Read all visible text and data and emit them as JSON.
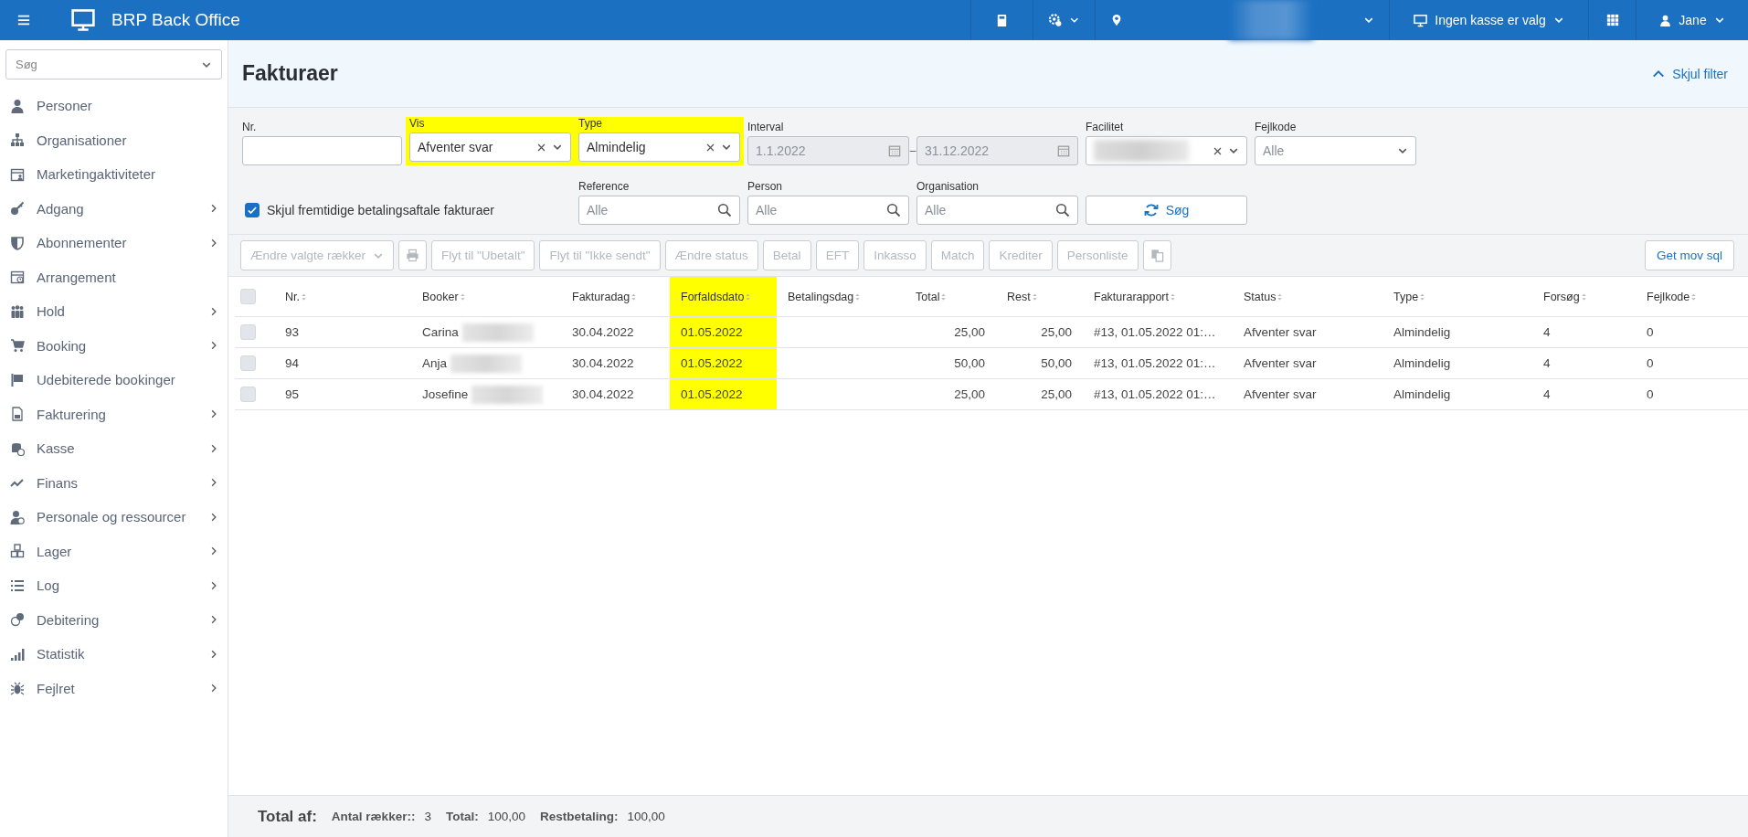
{
  "topbar": {
    "title": "BRP Back Office",
    "items": [
      {
        "kind": "book",
        "dropdown": false
      },
      {
        "kind": "settings",
        "dropdown": true
      },
      {
        "kind": "location",
        "blurred": true,
        "dropdown": true
      },
      {
        "kind": "register",
        "label": "Ingen kasse er valg",
        "dropdown": true
      },
      {
        "kind": "apps",
        "dropdown": false
      },
      {
        "kind": "user",
        "label": "Jane",
        "dropdown": true
      }
    ]
  },
  "sidebar": {
    "search": {
      "placeholder": "Søg"
    },
    "items": [
      {
        "label": "Personer",
        "has_submenu": false
      },
      {
        "label": "Organisationer",
        "has_submenu": false
      },
      {
        "label": "Marketingaktiviteter",
        "has_submenu": false
      },
      {
        "label": "Adgang",
        "has_submenu": true
      },
      {
        "label": "Abonnementer",
        "has_submenu": true
      },
      {
        "label": "Arrangement",
        "has_submenu": false
      },
      {
        "label": "Hold",
        "has_submenu": true
      },
      {
        "label": "Booking",
        "has_submenu": true
      },
      {
        "label": "Udebiterede bookinger",
        "has_submenu": false
      },
      {
        "label": "Fakturering",
        "has_submenu": true
      },
      {
        "label": "Kasse",
        "has_submenu": true
      },
      {
        "label": "Finans",
        "has_submenu": true
      },
      {
        "label": "Personale og ressourcer",
        "has_submenu": true
      },
      {
        "label": "Lager",
        "has_submenu": true
      },
      {
        "label": "Log",
        "has_submenu": true
      },
      {
        "label": "Debitering",
        "has_submenu": true
      },
      {
        "label": "Statistik",
        "has_submenu": true
      },
      {
        "label": "Fejlret",
        "has_submenu": true
      }
    ]
  },
  "page": {
    "title": "Fakturaer",
    "filter_toggle": "Skjul filter"
  },
  "filters": {
    "row1": [
      {
        "kind": "input",
        "label": "Nr.",
        "highlighted": false
      },
      {
        "kind": "select",
        "label": "Vis",
        "value": "Afventer svar",
        "clearable": true,
        "highlighted": true
      },
      {
        "kind": "select",
        "label": "Type",
        "value": "Almindelig",
        "clearable": true,
        "highlighted": true
      },
      {
        "kind": "range",
        "label": "Interval",
        "from": "1.1.2022",
        "to": "31.12.2022",
        "separator": "–",
        "disabled": true,
        "highlighted": false
      },
      {
        "kind": "select",
        "label": "Facilitet",
        "blurred": true,
        "clearable": true,
        "highlighted": false
      },
      {
        "kind": "select",
        "label": "Fejlkode",
        "placeholder": "Alle",
        "clearable": false,
        "highlighted": false
      }
    ],
    "hide_future": {
      "label": "Skjul fremtidige betalingsaftale fakturaer",
      "checked": true
    },
    "row2": [
      {
        "kind": "search",
        "label": "Reference",
        "placeholder": "Alle"
      },
      {
        "kind": "search",
        "label": "Person",
        "placeholder": "Alle"
      },
      {
        "kind": "search",
        "label": "Organisation",
        "placeholder": "Alle"
      },
      {
        "kind": "button",
        "label": "Søg"
      }
    ]
  },
  "toolbar": {
    "buttons": [
      {
        "kind": "dropdown",
        "label": "Ændre valgte rækker",
        "disabled": true
      },
      {
        "kind": "print",
        "disabled": true
      },
      {
        "kind": "text",
        "label": "Flyt til \"Ubetalt\"",
        "disabled": true
      },
      {
        "kind": "text",
        "label": "Flyt til \"Ikke sendt\"",
        "disabled": true
      },
      {
        "kind": "text",
        "label": "Ændre status",
        "disabled": true
      },
      {
        "kind": "text",
        "label": "Betal",
        "disabled": true
      },
      {
        "kind": "text",
        "label": "EFT",
        "disabled": true
      },
      {
        "kind": "text",
        "label": "Inkasso",
        "disabled": true
      },
      {
        "kind": "text",
        "label": "Match",
        "disabled": true
      },
      {
        "kind": "text",
        "label": "Krediter",
        "disabled": true
      },
      {
        "kind": "text",
        "label": "Personliste",
        "disabled": true
      },
      {
        "kind": "copy",
        "disabled": true
      }
    ],
    "right_button": {
      "label": "Get mov sql",
      "disabled": false
    }
  },
  "table": {
    "select_all": {
      "checked": false
    },
    "columns": [
      {
        "label": "Nr.",
        "highlighted": false,
        "kind": "text"
      },
      {
        "label": "Booker",
        "highlighted": false,
        "kind": "text"
      },
      {
        "label": "Fakturadag",
        "highlighted": false,
        "kind": "text"
      },
      {
        "label": "Forfaldsdato",
        "highlighted": true,
        "kind": "text"
      },
      {
        "label": "Betalingsdag",
        "highlighted": false,
        "kind": "text"
      },
      {
        "label": "Total",
        "highlighted": false,
        "kind": "amount"
      },
      {
        "label": "Rest",
        "highlighted": false,
        "kind": "amount"
      },
      {
        "label": "Fakturarapport",
        "highlighted": false,
        "kind": "text"
      },
      {
        "label": "Status",
        "highlighted": false,
        "kind": "text"
      },
      {
        "label": "Type",
        "highlighted": false,
        "kind": "text"
      },
      {
        "label": "Forsøg",
        "highlighted": false,
        "kind": "text"
      },
      {
        "label": "Fejlkode",
        "highlighted": false,
        "kind": "text"
      }
    ],
    "rows": [
      {
        "selected": false,
        "booker_blurred": true,
        "cells": [
          "93",
          "Carina",
          "30.04.2022",
          "01.05.2022",
          null,
          "25,00",
          "25,00",
          "#13, 01.05.2022 01:…",
          "Afventer svar",
          "Almindelig",
          "4",
          "0"
        ]
      },
      {
        "selected": false,
        "booker_blurred": true,
        "cells": [
          "94",
          "Anja",
          "30.04.2022",
          "01.05.2022",
          null,
          "50,00",
          "50,00",
          "#13, 01.05.2022 01:…",
          "Afventer svar",
          "Almindelig",
          "4",
          "0"
        ]
      },
      {
        "selected": false,
        "booker_blurred": true,
        "cells": [
          "95",
          "Josefine",
          "30.04.2022",
          "01.05.2022",
          null,
          "25,00",
          "25,00",
          "#13, 01.05.2022 01:…",
          "Afventer svar",
          "Almindelig",
          "4",
          "0"
        ]
      }
    ]
  },
  "footer": {
    "title": "Total af:",
    "items": [
      {
        "label": "Antal rækker::",
        "value": "3"
      },
      {
        "label": "Total:",
        "value": "100,00"
      },
      {
        "label": "Restbetaling:",
        "value": "100,00"
      }
    ]
  }
}
